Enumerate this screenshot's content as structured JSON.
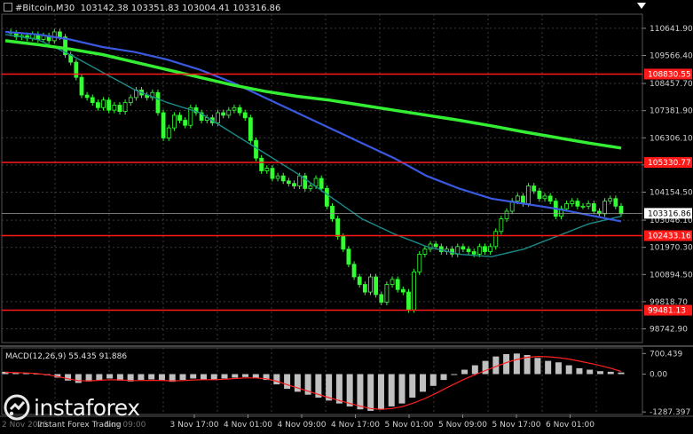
{
  "header": {
    "symbol": "#Bitcoin,M30",
    "ohlc": "103142.38 103351.83 103004.41 103316.86"
  },
  "price_axis": {
    "labels": [
      "110641.90",
      "109566.40",
      "108457.70",
      "107381.90",
      "106306.10",
      "105230.40",
      "104154.50",
      "103046.10",
      "101970.30",
      "100894.50",
      "99818.70",
      "98742.90"
    ]
  },
  "levels": [
    {
      "price": "108830.55",
      "color": "#ff1a1a"
    },
    {
      "price": "105330.77",
      "color": "#ff1a1a"
    },
    {
      "price": "102433.16",
      "color": "#ff1a1a"
    },
    {
      "price": "99481.13",
      "color": "#ff1a1a"
    }
  ],
  "current_price": "103316.86",
  "macd": {
    "label": "MACD(12,26,9) 55.435 91.886",
    "axis": [
      "700.439",
      "0.00",
      "-1287.397"
    ]
  },
  "time_axis": {
    "labels": [
      "3 Nov 17:00",
      "4 Nov 01:00",
      "4 Nov 09:00",
      "4 Nov 17:00",
      "5 Nov 01:00",
      "5 Nov 09:00",
      "5 Nov 17:00",
      "6 Nov 01:00"
    ],
    "partial_labels": [
      "2 Nov 2025",
      "Nov 09:00"
    ]
  },
  "logo": {
    "name": "instaforex",
    "tagline": "Instant Forex Trading"
  },
  "colors": {
    "background": "#000000",
    "candle": "#33ff33",
    "ma_slow": "#33ee33",
    "ma_mid": "#3a59e0",
    "ma_fast": "#1c8a8a",
    "level": "#ff1a1a",
    "macd_hist": "#c0c0c0",
    "macd_signal": "#ff2020",
    "grid": "#3a3a3a"
  },
  "chart_data": {
    "type": "line",
    "title": "#Bitcoin,M30",
    "ylim": [
      98200,
      111200
    ],
    "close_series": [
      110500,
      110450,
      110300,
      110350,
      110250,
      110400,
      110200,
      110350,
      110150,
      110500,
      110300,
      109600,
      109300,
      108700,
      108000,
      107900,
      107700,
      107500,
      107800,
      107400,
      107600,
      107350,
      107700,
      107900,
      108200,
      108000,
      107900,
      108100,
      107300,
      106300,
      106700,
      107200,
      107000,
      106800,
      107500,
      107300,
      107000,
      107100,
      106900,
      107300,
      107200,
      107400,
      107500,
      107300,
      107100,
      106200,
      105500,
      105000,
      105100,
      104700,
      104800,
      104600,
      104500,
      104400,
      104800,
      104300,
      104400,
      104700,
      104300,
      103600,
      103100,
      102400,
      101900,
      101300,
      100800,
      100500,
      100200,
      100800,
      100100,
      99800,
      100500,
      100700,
      100300,
      100200,
      99500,
      101000,
      101700,
      101900,
      102100,
      102000,
      101800,
      101900,
      101700,
      102000,
      101900,
      101800,
      101700,
      102000,
      101800,
      102000,
      102600,
      103100,
      103400,
      103800,
      104000,
      103700,
      104400,
      104200,
      103900,
      104000,
      103800,
      103200,
      103500,
      103700,
      103800,
      103600,
      103600,
      103700,
      103400,
      103300,
      103800,
      103900,
      103600,
      103300
    ],
    "series_ma": {
      "ma_slow": [
        110150,
        110000,
        109820,
        109600,
        109300,
        109000,
        108700,
        108400,
        108150,
        107950,
        107800,
        107600,
        107400,
        107200,
        107000,
        106780,
        106540,
        106320,
        106100,
        105900
      ],
      "ma_mid": [
        110500,
        110400,
        110200,
        109900,
        109700,
        109400,
        109000,
        108500,
        107900,
        107300,
        106700,
        106100,
        105500,
        104800,
        104300,
        103900,
        103700,
        103500,
        103250,
        103000
      ],
      "ma_fast": [
        110400,
        110200,
        109600,
        108900,
        108200,
        107700,
        107300,
        106500,
        105700,
        104900,
        104000,
        103100,
        102500,
        102000,
        101700,
        101600,
        101900,
        102400,
        102900,
        103200
      ]
    },
    "macd_hist": [
      80,
      60,
      40,
      20,
      -40,
      -120,
      -220,
      -300,
      -250,
      -200,
      -150,
      -220,
      -250,
      -200,
      -180,
      -230,
      -260,
      -200,
      -150,
      -180,
      -200,
      -150,
      -120,
      -100,
      -130,
      -200,
      -350,
      -500,
      -600,
      -700,
      -800,
      -900,
      -1000,
      -1100,
      -1200,
      -1250,
      -1200,
      -1100,
      -1000,
      -800,
      -600,
      -400,
      -200,
      0,
      150,
      300,
      450,
      600,
      680,
      700,
      650,
      550,
      450,
      400,
      300,
      200,
      150,
      100,
      80,
      55
    ],
    "macd_signal": [
      60,
      50,
      40,
      20,
      -20,
      -80,
      -160,
      -220,
      -230,
      -210,
      -190,
      -200,
      -220,
      -220,
      -210,
      -215,
      -230,
      -220,
      -200,
      -190,
      -190,
      -175,
      -150,
      -130,
      -130,
      -160,
      -240,
      -360,
      -470,
      -580,
      -690,
      -800,
      -900,
      -1000,
      -1090,
      -1170,
      -1200,
      -1170,
      -1110,
      -1000,
      -860,
      -700,
      -520,
      -340,
      -170,
      -20,
      120,
      260,
      390,
      500,
      570,
      600,
      590,
      560,
      510,
      440,
      370,
      290,
      200,
      92
    ]
  }
}
